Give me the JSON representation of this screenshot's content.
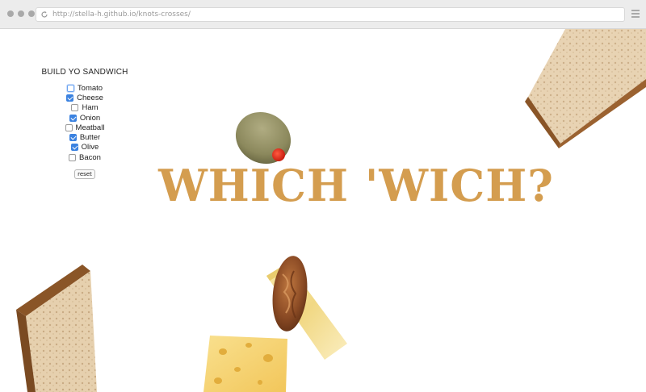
{
  "browser": {
    "url": "http://stella-h.github.io/knots-crosses/"
  },
  "panel": {
    "title": "BUILD YO SANDWICH",
    "options": [
      {
        "label": "Tomato",
        "checked": false,
        "focused": true
      },
      {
        "label": "Cheese",
        "checked": true,
        "focused": false
      },
      {
        "label": "Ham",
        "checked": false,
        "focused": false
      },
      {
        "label": "Onion",
        "checked": true,
        "focused": false
      },
      {
        "label": "Meatball",
        "checked": false,
        "focused": false
      },
      {
        "label": "Butter",
        "checked": true,
        "focused": false
      },
      {
        "label": "Olive",
        "checked": true,
        "focused": false
      },
      {
        "label": "Bacon",
        "checked": false,
        "focused": false
      }
    ],
    "reset_label": "reset"
  },
  "hero": {
    "title": "WHICH 'WICH?",
    "color": "#d49d4f"
  },
  "scene": {
    "objects": [
      "bread-slice",
      "olive",
      "meatball",
      "butter-stick",
      "cheese-slice",
      "bread-slice"
    ]
  }
}
